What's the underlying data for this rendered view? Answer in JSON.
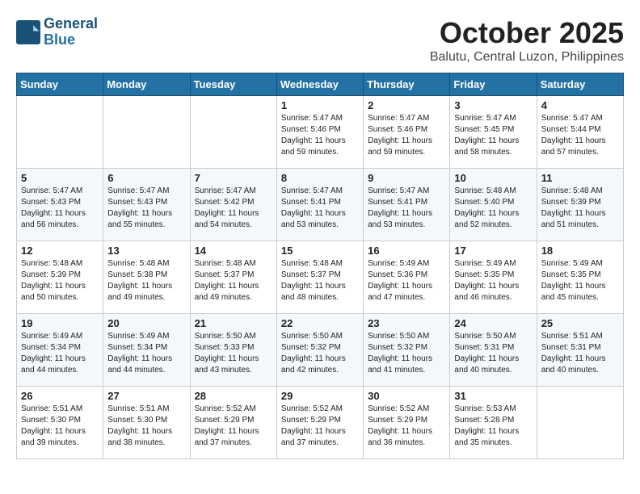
{
  "header": {
    "logo_line1": "General",
    "logo_line2": "Blue",
    "month": "October 2025",
    "location": "Balutu, Central Luzon, Philippines"
  },
  "weekdays": [
    "Sunday",
    "Monday",
    "Tuesday",
    "Wednesday",
    "Thursday",
    "Friday",
    "Saturday"
  ],
  "weeks": [
    [
      {
        "day": "",
        "sunrise": "",
        "sunset": "",
        "daylight": ""
      },
      {
        "day": "",
        "sunrise": "",
        "sunset": "",
        "daylight": ""
      },
      {
        "day": "",
        "sunrise": "",
        "sunset": "",
        "daylight": ""
      },
      {
        "day": "1",
        "sunrise": "5:47 AM",
        "sunset": "5:46 PM",
        "daylight": "11 hours and 59 minutes."
      },
      {
        "day": "2",
        "sunrise": "5:47 AM",
        "sunset": "5:46 PM",
        "daylight": "11 hours and 59 minutes."
      },
      {
        "day": "3",
        "sunrise": "5:47 AM",
        "sunset": "5:45 PM",
        "daylight": "11 hours and 58 minutes."
      },
      {
        "day": "4",
        "sunrise": "5:47 AM",
        "sunset": "5:44 PM",
        "daylight": "11 hours and 57 minutes."
      }
    ],
    [
      {
        "day": "5",
        "sunrise": "5:47 AM",
        "sunset": "5:43 PM",
        "daylight": "11 hours and 56 minutes."
      },
      {
        "day": "6",
        "sunrise": "5:47 AM",
        "sunset": "5:43 PM",
        "daylight": "11 hours and 55 minutes."
      },
      {
        "day": "7",
        "sunrise": "5:47 AM",
        "sunset": "5:42 PM",
        "daylight": "11 hours and 54 minutes."
      },
      {
        "day": "8",
        "sunrise": "5:47 AM",
        "sunset": "5:41 PM",
        "daylight": "11 hours and 53 minutes."
      },
      {
        "day": "9",
        "sunrise": "5:47 AM",
        "sunset": "5:41 PM",
        "daylight": "11 hours and 53 minutes."
      },
      {
        "day": "10",
        "sunrise": "5:48 AM",
        "sunset": "5:40 PM",
        "daylight": "11 hours and 52 minutes."
      },
      {
        "day": "11",
        "sunrise": "5:48 AM",
        "sunset": "5:39 PM",
        "daylight": "11 hours and 51 minutes."
      }
    ],
    [
      {
        "day": "12",
        "sunrise": "5:48 AM",
        "sunset": "5:39 PM",
        "daylight": "11 hours and 50 minutes."
      },
      {
        "day": "13",
        "sunrise": "5:48 AM",
        "sunset": "5:38 PM",
        "daylight": "11 hours and 49 minutes."
      },
      {
        "day": "14",
        "sunrise": "5:48 AM",
        "sunset": "5:37 PM",
        "daylight": "11 hours and 49 minutes."
      },
      {
        "day": "15",
        "sunrise": "5:48 AM",
        "sunset": "5:37 PM",
        "daylight": "11 hours and 48 minutes."
      },
      {
        "day": "16",
        "sunrise": "5:49 AM",
        "sunset": "5:36 PM",
        "daylight": "11 hours and 47 minutes."
      },
      {
        "day": "17",
        "sunrise": "5:49 AM",
        "sunset": "5:35 PM",
        "daylight": "11 hours and 46 minutes."
      },
      {
        "day": "18",
        "sunrise": "5:49 AM",
        "sunset": "5:35 PM",
        "daylight": "11 hours and 45 minutes."
      }
    ],
    [
      {
        "day": "19",
        "sunrise": "5:49 AM",
        "sunset": "5:34 PM",
        "daylight": "11 hours and 44 minutes."
      },
      {
        "day": "20",
        "sunrise": "5:49 AM",
        "sunset": "5:34 PM",
        "daylight": "11 hours and 44 minutes."
      },
      {
        "day": "21",
        "sunrise": "5:50 AM",
        "sunset": "5:33 PM",
        "daylight": "11 hours and 43 minutes."
      },
      {
        "day": "22",
        "sunrise": "5:50 AM",
        "sunset": "5:32 PM",
        "daylight": "11 hours and 42 minutes."
      },
      {
        "day": "23",
        "sunrise": "5:50 AM",
        "sunset": "5:32 PM",
        "daylight": "11 hours and 41 minutes."
      },
      {
        "day": "24",
        "sunrise": "5:50 AM",
        "sunset": "5:31 PM",
        "daylight": "11 hours and 40 minutes."
      },
      {
        "day": "25",
        "sunrise": "5:51 AM",
        "sunset": "5:31 PM",
        "daylight": "11 hours and 40 minutes."
      }
    ],
    [
      {
        "day": "26",
        "sunrise": "5:51 AM",
        "sunset": "5:30 PM",
        "daylight": "11 hours and 39 minutes."
      },
      {
        "day": "27",
        "sunrise": "5:51 AM",
        "sunset": "5:30 PM",
        "daylight": "11 hours and 38 minutes."
      },
      {
        "day": "28",
        "sunrise": "5:52 AM",
        "sunset": "5:29 PM",
        "daylight": "11 hours and 37 minutes."
      },
      {
        "day": "29",
        "sunrise": "5:52 AM",
        "sunset": "5:29 PM",
        "daylight": "11 hours and 37 minutes."
      },
      {
        "day": "30",
        "sunrise": "5:52 AM",
        "sunset": "5:29 PM",
        "daylight": "11 hours and 36 minutes."
      },
      {
        "day": "31",
        "sunrise": "5:53 AM",
        "sunset": "5:28 PM",
        "daylight": "11 hours and 35 minutes."
      },
      {
        "day": "",
        "sunrise": "",
        "sunset": "",
        "daylight": ""
      }
    ]
  ]
}
